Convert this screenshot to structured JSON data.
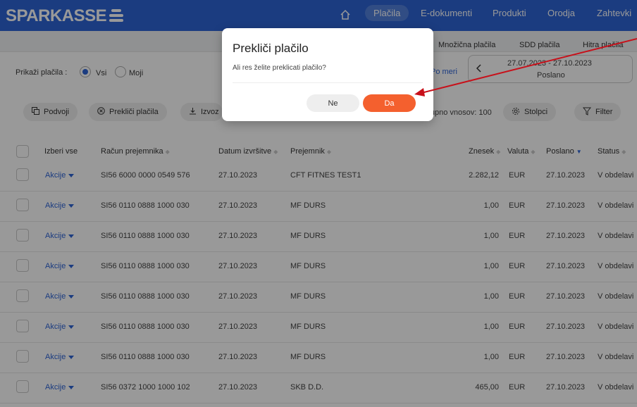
{
  "header": {
    "logo": "SPARKASSE",
    "nav": [
      "Plačila",
      "E-dokumenti",
      "Produkti",
      "Orodja",
      "Zahtevki"
    ]
  },
  "subnav": [
    "Množična plačila",
    "SDD plačila",
    "Hitra plačila"
  ],
  "filters": {
    "show_label": "Prikaži plačila :",
    "opt_all": "Vsi",
    "opt_mine": "Moji",
    "custom": "Po meri",
    "date_range": "27.07.2023 - 27.10.2023",
    "date_status": "Poslano"
  },
  "toolbar": {
    "duplicate": "Podvoji",
    "cancel_payments": "Prekliči plačila",
    "export": "Izvoz",
    "total": "Skupno vnosov: 100",
    "columns": "Stolpci",
    "filter": "Filter"
  },
  "table": {
    "headers": [
      "Izberi vse",
      "Račun prejemnika",
      "Datum izvršitve",
      "Prejemnik",
      "Znesek",
      "Valuta",
      "Poslano",
      "Status"
    ],
    "action_label": "Akcije",
    "rows": [
      {
        "account": "SI56 6000 0000 0549 576",
        "date": "27.10.2023",
        "recipient": "CFT FITNES TEST1",
        "amount": "2.282,12",
        "currency": "EUR",
        "sent": "27.10.2023",
        "status": "V obdelavi"
      },
      {
        "account": "SI56 0110 0888 1000 030",
        "date": "27.10.2023",
        "recipient": "MF DURS",
        "amount": "1,00",
        "currency": "EUR",
        "sent": "27.10.2023",
        "status": "V obdelavi"
      },
      {
        "account": "SI56 0110 0888 1000 030",
        "date": "27.10.2023",
        "recipient": "MF DURS",
        "amount": "1,00",
        "currency": "EUR",
        "sent": "27.10.2023",
        "status": "V obdelavi"
      },
      {
        "account": "SI56 0110 0888 1000 030",
        "date": "27.10.2023",
        "recipient": "MF DURS",
        "amount": "1,00",
        "currency": "EUR",
        "sent": "27.10.2023",
        "status": "V obdelavi"
      },
      {
        "account": "SI56 0110 0888 1000 030",
        "date": "27.10.2023",
        "recipient": "MF DURS",
        "amount": "1,00",
        "currency": "EUR",
        "sent": "27.10.2023",
        "status": "V obdelavi"
      },
      {
        "account": "SI56 0110 0888 1000 030",
        "date": "27.10.2023",
        "recipient": "MF DURS",
        "amount": "1,00",
        "currency": "EUR",
        "sent": "27.10.2023",
        "status": "V obdelavi"
      },
      {
        "account": "SI56 0110 0888 1000 030",
        "date": "27.10.2023",
        "recipient": "MF DURS",
        "amount": "1,00",
        "currency": "EUR",
        "sent": "27.10.2023",
        "status": "V obdelavi"
      },
      {
        "account": "SI56 0372 1000 1000 102",
        "date": "27.10.2023",
        "recipient": "SKB D.D.",
        "amount": "465,00",
        "currency": "EUR",
        "sent": "27.10.2023",
        "status": "V obdelavi"
      }
    ]
  },
  "dialog": {
    "title": "Prekliči plačilo",
    "message": "Ali res želite preklicati plačilo?",
    "no_label": "Ne",
    "yes_label": "Da"
  },
  "colors": {
    "brand": "#2e64d6",
    "accent": "#f4602e",
    "annotation": "#c8101a"
  },
  "icons": [
    "home-icon",
    "duplicate-icon",
    "cancel-circle-icon",
    "download-icon",
    "gear-icon",
    "filter-icon",
    "chevron-left-icon",
    "caret-down-icon"
  ]
}
